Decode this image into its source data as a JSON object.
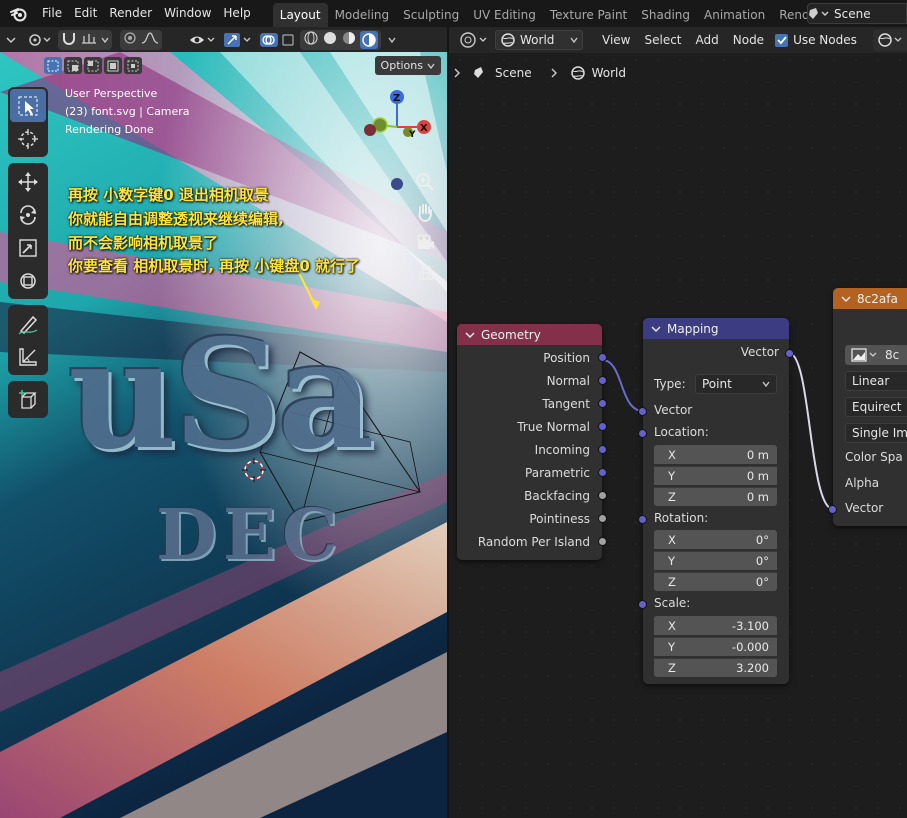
{
  "menubar": {
    "items": [
      "File",
      "Edit",
      "Render",
      "Window",
      "Help"
    ],
    "workspaces": [
      "Layout",
      "Modeling",
      "Sculpting",
      "UV Editing",
      "Texture Paint",
      "Shading",
      "Animation",
      "Rendering"
    ],
    "active_workspace": "Layout",
    "scene": "Scene"
  },
  "viewport": {
    "options_label": "Options",
    "info": [
      "User Perspective",
      "(23) font.svg | Camera",
      "Rendering Done"
    ],
    "annotations": [
      "再按 小数字键0 退出相机取景",
      "你就能自由调整透视来继续编辑,",
      "而不会影响相机取景了",
      "你要查看 相机取景时, 再按 小键盘0 就行了"
    ],
    "scene_text": [
      "uSa",
      "DEC"
    ],
    "gizmo": {
      "z": "Z",
      "y": "Y",
      "x": "X"
    },
    "gizmo_colors": {
      "x": "#e2413e",
      "y": "#8cbf2c",
      "z": "#3b6be0"
    },
    "annotation_color": "#ffe43a"
  },
  "node_editor": {
    "world_label": "World",
    "menu": [
      "View",
      "Select",
      "Add",
      "Node"
    ],
    "use_nodes_label": "Use Nodes",
    "breadcrumb": [
      "Scene",
      "World"
    ],
    "geometry": {
      "title": "Geometry",
      "header_color": "#83314a",
      "outputs": [
        "Position",
        "Normal",
        "Tangent",
        "True Normal",
        "Incoming",
        "Parametric",
        "Backfacing",
        "Pointiness",
        "Random Per Island"
      ]
    },
    "mapping": {
      "title": "Mapping",
      "header_color": "#3c3c83",
      "output": "Vector",
      "type_label": "Type:",
      "type_value": "Point",
      "vector_label": "Vector",
      "location_label": "Location:",
      "location": [
        {
          "axis": "X",
          "value": "0 m"
        },
        {
          "axis": "Y",
          "value": "0 m"
        },
        {
          "axis": "Z",
          "value": "0 m"
        }
      ],
      "rotation_label": "Rotation:",
      "rotation": [
        {
          "axis": "X",
          "value": "0°"
        },
        {
          "axis": "Y",
          "value": "0°"
        },
        {
          "axis": "Z",
          "value": "0°"
        }
      ],
      "scale_label": "Scale:",
      "scale": [
        {
          "axis": "X",
          "value": "-3.100"
        },
        {
          "axis": "Y",
          "value": "-0.000"
        },
        {
          "axis": "Z",
          "value": "3.200"
        }
      ]
    },
    "image_node": {
      "title": "8c2afa",
      "header_color": "#b3631f",
      "image_value": "8c",
      "interpolation": "Linear",
      "projection": "Equirect",
      "extension": "Single Im",
      "color_space_label": "Color Spa",
      "alpha_label": "Alpha",
      "vector_label": "Vector"
    }
  }
}
